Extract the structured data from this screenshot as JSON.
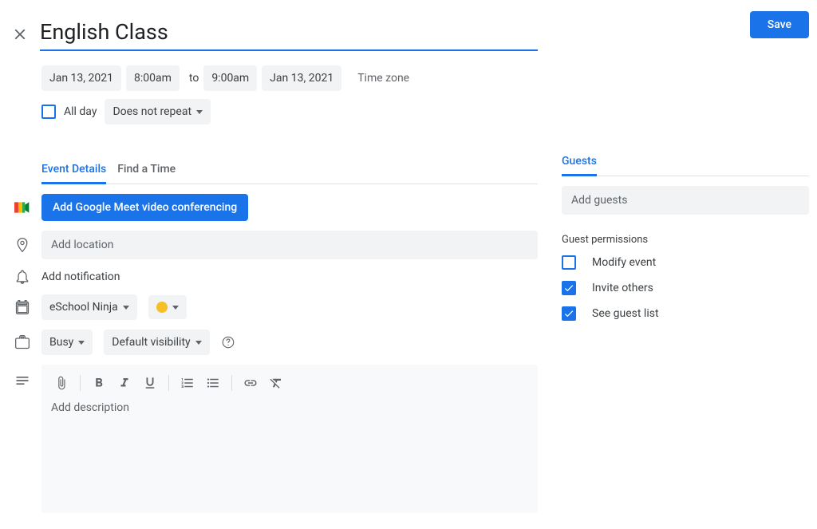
{
  "header": {
    "title": "English Class",
    "save_label": "Save"
  },
  "datetime": {
    "start_date": "Jan 13, 2021",
    "start_time": "8:00am",
    "to": "to",
    "end_time": "9:00am",
    "end_date": "Jan 13, 2021",
    "timezone_link": "Time zone"
  },
  "allday": {
    "label": "All day",
    "checked": false
  },
  "recurrence": {
    "label": "Does not repeat"
  },
  "tabs": {
    "details": "Event Details",
    "findtime": "Find a Time"
  },
  "meet": {
    "button": "Add Google Meet video conferencing"
  },
  "location": {
    "placeholder": "Add location"
  },
  "notification": {
    "label": "Add notification"
  },
  "calendar": {
    "name": "eSchool Ninja",
    "color": "#f6bf26"
  },
  "availability": {
    "label": "Busy"
  },
  "visibility": {
    "label": "Default visibility"
  },
  "description": {
    "placeholder": "Add description"
  },
  "guests": {
    "tab": "Guests",
    "placeholder": "Add guests",
    "permissions_title": "Guest permissions",
    "perms": {
      "modify": {
        "label": "Modify event",
        "checked": false
      },
      "invite": {
        "label": "Invite others",
        "checked": true
      },
      "seelist": {
        "label": "See guest list",
        "checked": true
      }
    }
  }
}
